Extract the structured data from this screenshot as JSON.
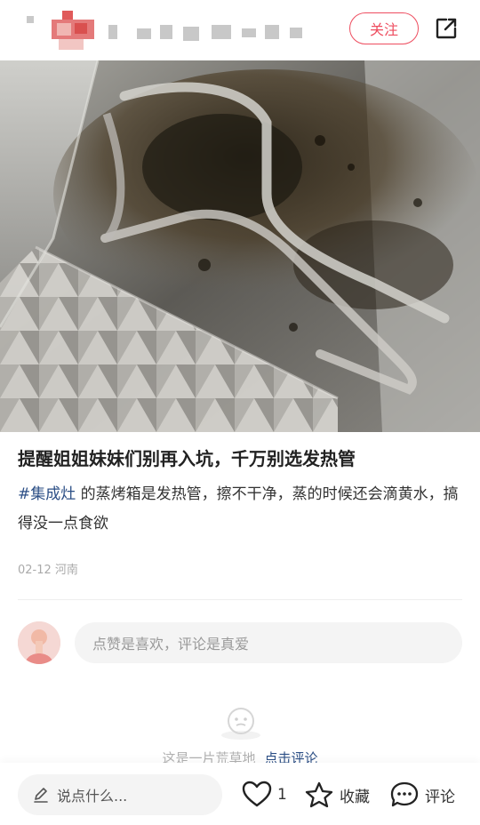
{
  "header": {
    "follow_label": "关注"
  },
  "post": {
    "title": "提醒姐姐妹妹们别再入坑，千万别选发热管",
    "tag": "#集成灶",
    "body": " 的蒸烤箱是发热管，擦不干净，蒸的时候还会滴黄水，搞得没一点食欲",
    "date": "02-12",
    "location": "河南"
  },
  "comment_box": {
    "placeholder": "点赞是喜欢，评论是真爱"
  },
  "empty_state": {
    "text": "这是一片荒草地",
    "link": "点击评论"
  },
  "bottom_bar": {
    "input_placeholder": "说点什么...",
    "like_count": "1",
    "collect_label": "收藏",
    "comment_label": "评论"
  },
  "icons": [
    "share-icon",
    "pencil-icon",
    "heart-icon",
    "star-icon",
    "comment-bubble-icon",
    "empty-face-icon"
  ],
  "colors": {
    "accent": "#ee4d5f",
    "link": "#2c4f86",
    "muted": "#aaaaaa"
  }
}
